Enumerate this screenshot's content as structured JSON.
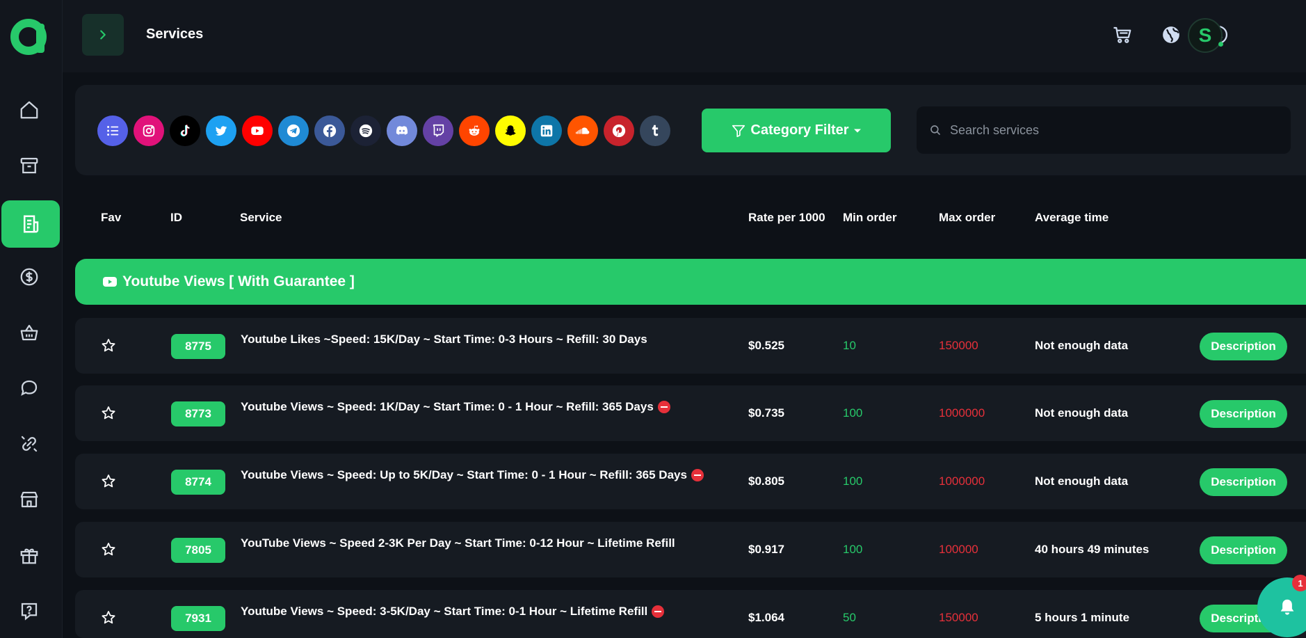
{
  "app": {
    "logo_letter": "a",
    "brand_color": "#27c96a"
  },
  "header": {
    "title": "Services",
    "avatar_initial": "S"
  },
  "sidebar": {
    "items": [
      {
        "icon": "home-icon"
      },
      {
        "icon": "archive-icon"
      },
      {
        "icon": "services-icon",
        "active": true
      },
      {
        "icon": "dollar-icon"
      },
      {
        "icon": "basket-icon"
      },
      {
        "icon": "chat-icon"
      },
      {
        "icon": "affiliate-icon"
      },
      {
        "icon": "store-icon"
      },
      {
        "icon": "gift-icon"
      },
      {
        "icon": "help-icon"
      }
    ]
  },
  "filters": {
    "platforms": [
      {
        "name": "all",
        "color": "#5561e8"
      },
      {
        "name": "instagram",
        "color": "#e1127a"
      },
      {
        "name": "tiktok",
        "color": "#000000"
      },
      {
        "name": "twitter",
        "color": "#1da1f2"
      },
      {
        "name": "youtube",
        "color": "#ff0000"
      },
      {
        "name": "telegram",
        "color": "#1f8ad4"
      },
      {
        "name": "facebook",
        "color": "#3b5998"
      },
      {
        "name": "spotify",
        "color": "#1c2235"
      },
      {
        "name": "discord",
        "color": "#7289da"
      },
      {
        "name": "twitch",
        "color": "#6441a5"
      },
      {
        "name": "reddit",
        "color": "#ff4500"
      },
      {
        "name": "snapchat",
        "color": "#fffc00"
      },
      {
        "name": "linkedin",
        "color": "#0e76a8"
      },
      {
        "name": "soundcloud",
        "color": "#ff5500"
      },
      {
        "name": "pinterest",
        "color": "#c8232c"
      },
      {
        "name": "tumblr",
        "color": "#35465c"
      }
    ],
    "category_filter_label": "Category Filter",
    "search_placeholder": "Search services"
  },
  "table": {
    "headers": {
      "fav": "Fav",
      "id": "ID",
      "service": "Service",
      "rate": "Rate per 1000",
      "min": "Min order",
      "max": "Max order",
      "avg": "Average time"
    },
    "category": "Youtube Views [ With Guarantee ]",
    "rows": [
      {
        "id": "8775",
        "service": "Youtube Likes ~Speed: 15K/Day ~ Start Time: 0-3 Hours ~ Refill: 30 Days",
        "restricted": false,
        "rate": "$0.525",
        "min": "10",
        "max": "150000",
        "avg": "Not enough data",
        "action": "Description"
      },
      {
        "id": "8773",
        "service": "Youtube Views ~ Speed: 1K/Day ~ Start Time: 0 - 1 Hour ~ Refill: 365 Days",
        "restricted": true,
        "rate": "$0.735",
        "min": "100",
        "max": "1000000",
        "avg": "Not enough data",
        "action": "Description"
      },
      {
        "id": "8774",
        "service": "Youtube Views ~ Speed: Up to 5K/Day ~ Start Time: 0 - 1 Hour ~ Refill: 365 Days",
        "restricted": true,
        "rate": "$0.805",
        "min": "100",
        "max": "1000000",
        "avg": "Not enough data",
        "action": "Description"
      },
      {
        "id": "7805",
        "service": "YouTube Views ~ Speed 2-3K Per Day ~ Start Time: 0-12 Hour ~ Lifetime Refill",
        "restricted": false,
        "rate": "$0.917",
        "min": "100",
        "max": "100000",
        "avg": "40 hours 49 minutes",
        "action": "Description"
      },
      {
        "id": "7931",
        "service": "Youtube Views ~ Speed: 3-5K/Day ~ Start Time: 0-1 Hour ~ Lifetime Refill",
        "restricted": true,
        "rate": "$1.064",
        "min": "50",
        "max": "150000",
        "avg": "5 hours 1 minute",
        "action": "Description"
      }
    ]
  },
  "notifications": {
    "count": "1"
  }
}
